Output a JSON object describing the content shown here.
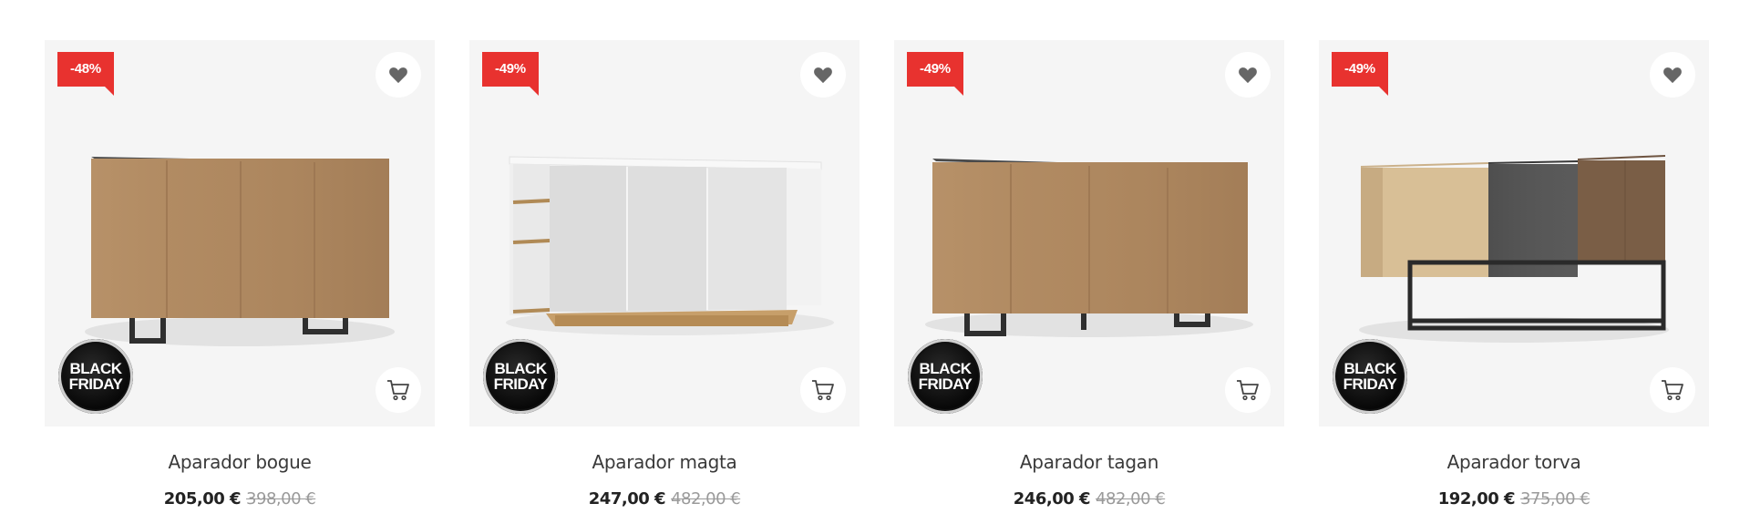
{
  "products": [
    {
      "name": "Aparador bogue",
      "discount": "-48%",
      "badge_line1": "BLACK",
      "badge_line2": "FRIDAY",
      "price": "205,00 €",
      "old_price": "398,00 €"
    },
    {
      "name": "Aparador magta",
      "discount": "-49%",
      "badge_line1": "BLACK",
      "badge_line2": "FRIDAY",
      "price": "247,00 €",
      "old_price": "482,00 €"
    },
    {
      "name": "Aparador tagan",
      "discount": "-49%",
      "badge_line1": "BLACK",
      "badge_line2": "FRIDAY",
      "price": "246,00 €",
      "old_price": "482,00 €"
    },
    {
      "name": "Aparador torva",
      "discount": "-49%",
      "badge_line1": "BLACK",
      "badge_line2": "FRIDAY",
      "price": "192,00 €",
      "old_price": "375,00 €"
    }
  ],
  "colors": {
    "discount_red": "#e8322f",
    "card_bg": "#f5f5f5",
    "icon_gray": "#666666"
  },
  "icons": {
    "wishlist": "heart-icon",
    "cart": "cart-icon"
  }
}
